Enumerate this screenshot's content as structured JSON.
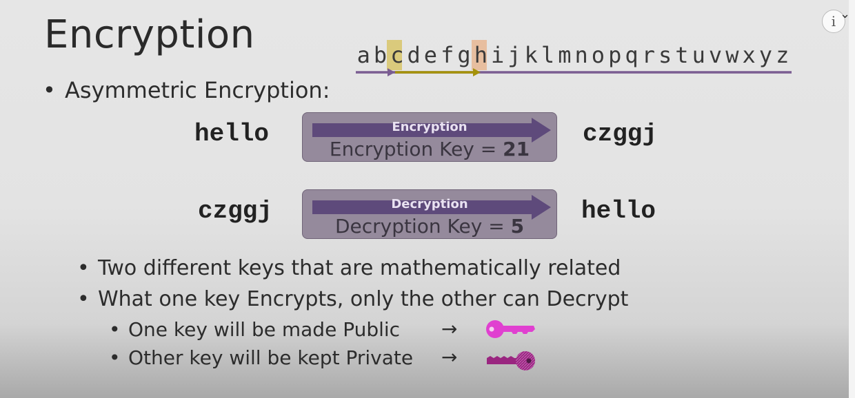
{
  "slide": {
    "title": "Encryption",
    "alphabet": [
      "a",
      "b",
      "c",
      "d",
      "e",
      "f",
      "g",
      "h",
      "i",
      "j",
      "k",
      "l",
      "m",
      "n",
      "o",
      "p",
      "q",
      "r",
      "s",
      "t",
      "u",
      "v",
      "w",
      "x",
      "y",
      "z"
    ],
    "highlight_start_letter": "c",
    "highlight_end_letter": "h",
    "heading_bullet": "Asymmetric Encryption:",
    "encryption_row": {
      "plaintext": "hello",
      "box_label": "Encryption",
      "key_label": "Encryption Key = ",
      "key_value": "21",
      "ciphertext": "czggj"
    },
    "decryption_row": {
      "ciphertext": "czggj",
      "box_label": "Decryption",
      "key_label": "Decryption Key = ",
      "key_value": "5",
      "plaintext": "hello"
    },
    "points": [
      "Two different keys that are mathematically related",
      "What one key Encrypts, only the other can Decrypt"
    ],
    "sub_points": [
      {
        "text": "One key will be made Public",
        "arrow": "→",
        "key_icon": "public-key-icon",
        "color": "#e040d0"
      },
      {
        "text": "Other key will be kept Private",
        "arrow": "→",
        "key_icon": "private-key-icon",
        "color": "#9a2680"
      }
    ]
  },
  "ui": {
    "info_glyph": "i",
    "expand_glyph": "⌄"
  },
  "colors": {
    "purple_line": "#7a5d92",
    "highlight_c": "#d8c66a",
    "highlight_h": "#e7b793",
    "olive_arrow": "#a5920a",
    "box_fill": "#958a9c",
    "arrow_fill": "#5e4a7b"
  }
}
